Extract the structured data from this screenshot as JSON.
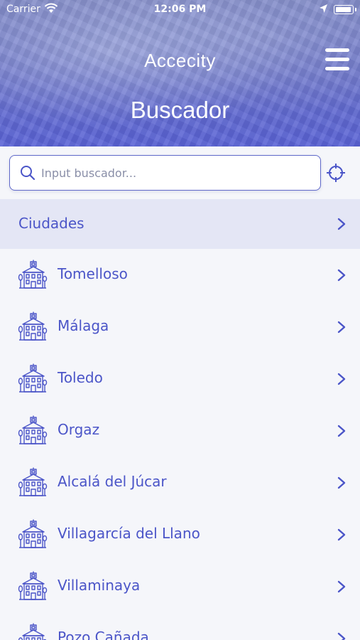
{
  "status_bar": {
    "carrier": "Carrier",
    "time": "12:06 PM"
  },
  "header": {
    "app_title": "Accecity",
    "page_title": "Buscador"
  },
  "search": {
    "placeholder": "Input buscador...",
    "value": ""
  },
  "section": {
    "title": "Ciudades"
  },
  "cities": [
    "Tomelloso",
    "Málaga",
    "Toledo",
    "Orgaz",
    "Alcalá del Júcar",
    "Villagarcía del Llano",
    "Villaminaya",
    "Pozo Cañada"
  ],
  "colors": {
    "accent": "#4b55c8",
    "header_bottom": "#5a63d6",
    "section_bg": "#e4e6f5",
    "page_bg": "#f5f6fa"
  },
  "icons": {
    "city": "building-icon",
    "row_arrow": "chevron-right-icon",
    "search": "search-icon",
    "locate": "crosshair-icon",
    "menu": "hamburger-menu-icon"
  }
}
